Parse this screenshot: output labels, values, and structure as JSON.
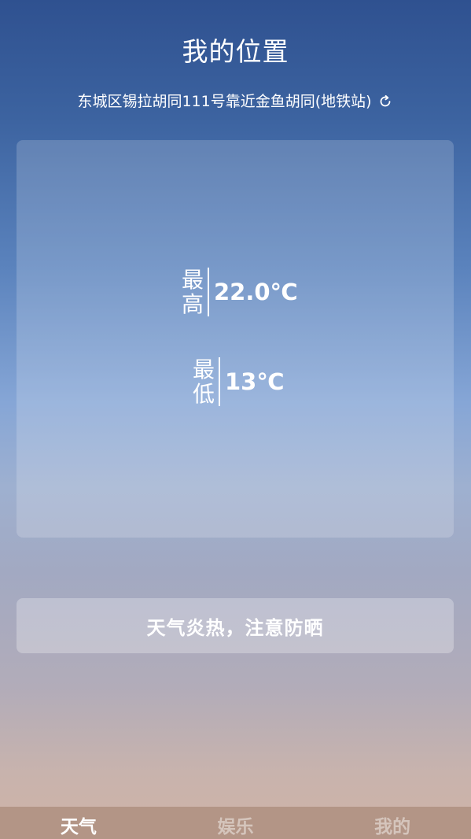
{
  "header": {
    "title": "我的位置",
    "location": "东城区锡拉胡同111号靠近金鱼胡同(地铁站)",
    "refresh_icon": "refresh-icon"
  },
  "temperature": {
    "high": {
      "label": "最高",
      "value": "22.0℃"
    },
    "low": {
      "label": "最低",
      "value": "13℃"
    }
  },
  "tip": {
    "text": "天气炎热，注意防晒"
  },
  "tabs": [
    {
      "label": "天气",
      "active": true
    },
    {
      "label": "娱乐",
      "active": false
    },
    {
      "label": "我的",
      "active": false
    }
  ],
  "colors": {
    "background_top": "#2f5190",
    "background_middle": "#86a6d6",
    "background_bottom": "#cfb3a6",
    "tab_bar": "#b39586",
    "text": "#ffffff"
  }
}
